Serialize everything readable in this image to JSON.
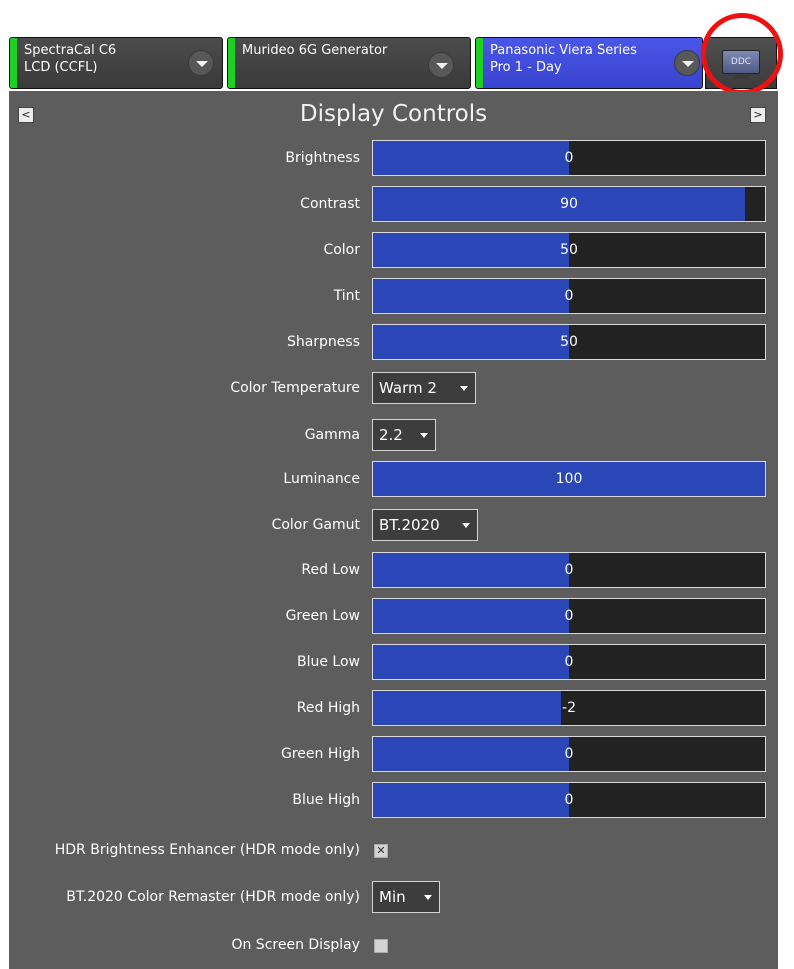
{
  "devices": [
    {
      "line1": "SpectraCal C6",
      "line2": "LCD (CCFL)"
    },
    {
      "line1": "Murideo 6G Generator",
      "line2": ""
    },
    {
      "line1": "Panasonic Viera Series",
      "line2": "Pro 1 - Day"
    }
  ],
  "ddc_label": "DDC",
  "panel": {
    "title": "Display Controls",
    "prev_label": "<",
    "next_label": ">"
  },
  "sliders": [
    {
      "label": "Brightness",
      "value": "0",
      "fill_fraction": 0.5
    },
    {
      "label": "Contrast",
      "value": "90",
      "fill_fraction": 0.95
    },
    {
      "label": "Color",
      "value": "50",
      "fill_fraction": 0.5
    },
    {
      "label": "Tint",
      "value": "0",
      "fill_fraction": 0.5
    },
    {
      "label": "Sharpness",
      "value": "50",
      "fill_fraction": 0.5
    },
    {
      "label": "Luminance",
      "value": "100",
      "fill_fraction": 1.0
    },
    {
      "label": "Red Low",
      "value": "0",
      "fill_fraction": 0.5
    },
    {
      "label": "Green Low",
      "value": "0",
      "fill_fraction": 0.5
    },
    {
      "label": "Blue Low",
      "value": "0",
      "fill_fraction": 0.5
    },
    {
      "label": "Red High",
      "value": "-2",
      "fill_fraction": 0.48
    },
    {
      "label": "Green High",
      "value": "0",
      "fill_fraction": 0.5
    },
    {
      "label": "Blue High",
      "value": "0",
      "fill_fraction": 0.5
    }
  ],
  "dropdowns": {
    "color_temperature": {
      "label": "Color Temperature",
      "value": "Warm 2"
    },
    "gamma": {
      "label": "Gamma",
      "value": "2.2"
    },
    "color_gamut": {
      "label": "Color Gamut",
      "value": "BT.2020"
    },
    "color_remaster": {
      "label": "BT.2020 Color Remaster (HDR mode only)",
      "value": "Min"
    }
  },
  "checkboxes": {
    "hdr_brightness": {
      "label": "HDR Brightness Enhancer (HDR mode only)",
      "checked": true,
      "mark": "✕"
    },
    "osd": {
      "label": "On Screen Display",
      "checked": false,
      "mark": ""
    }
  },
  "colors": {
    "accent_blue": "#2b46b6",
    "active_green": "#1fd024",
    "highlight_red": "#ee1111"
  }
}
